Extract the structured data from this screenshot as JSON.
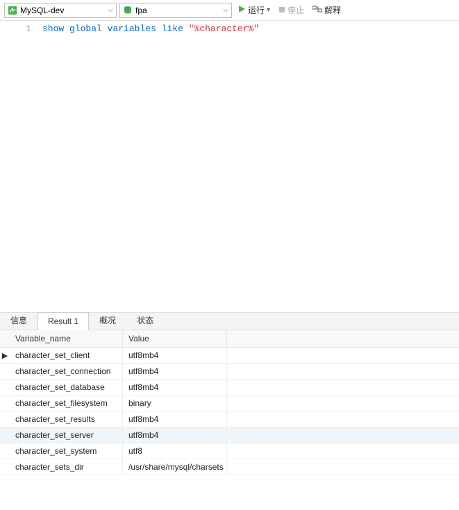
{
  "toolbar": {
    "connection": "MySQL-dev",
    "schema": "fpa",
    "run_label": "运行",
    "stop_label": "停止",
    "explain_label": "解释"
  },
  "editor": {
    "line_numbers": [
      "1"
    ],
    "tokens": {
      "kw1": "show",
      "kw2": "global",
      "kw3": "variables",
      "kw4": "like",
      "str1": "\"%character%\""
    }
  },
  "tabs": {
    "items": [
      "信息",
      "Result 1",
      "概况",
      "状态"
    ],
    "active_index": 1
  },
  "results": {
    "headers": [
      "Variable_name",
      "Value"
    ],
    "rows": [
      {
        "name": "character_set_client",
        "value": "utf8mb4",
        "current": true
      },
      {
        "name": "character_set_connection",
        "value": "utf8mb4"
      },
      {
        "name": "character_set_database",
        "value": "utf8mb4"
      },
      {
        "name": "character_set_filesystem",
        "value": "binary"
      },
      {
        "name": "character_set_results",
        "value": "utf8mb4"
      },
      {
        "name": "character_set_server",
        "value": "utf8mb4",
        "highlight": true
      },
      {
        "name": "character_set_system",
        "value": "utf8"
      },
      {
        "name": "character_sets_dir",
        "value": "/usr/share/mysql/charsets"
      }
    ]
  }
}
